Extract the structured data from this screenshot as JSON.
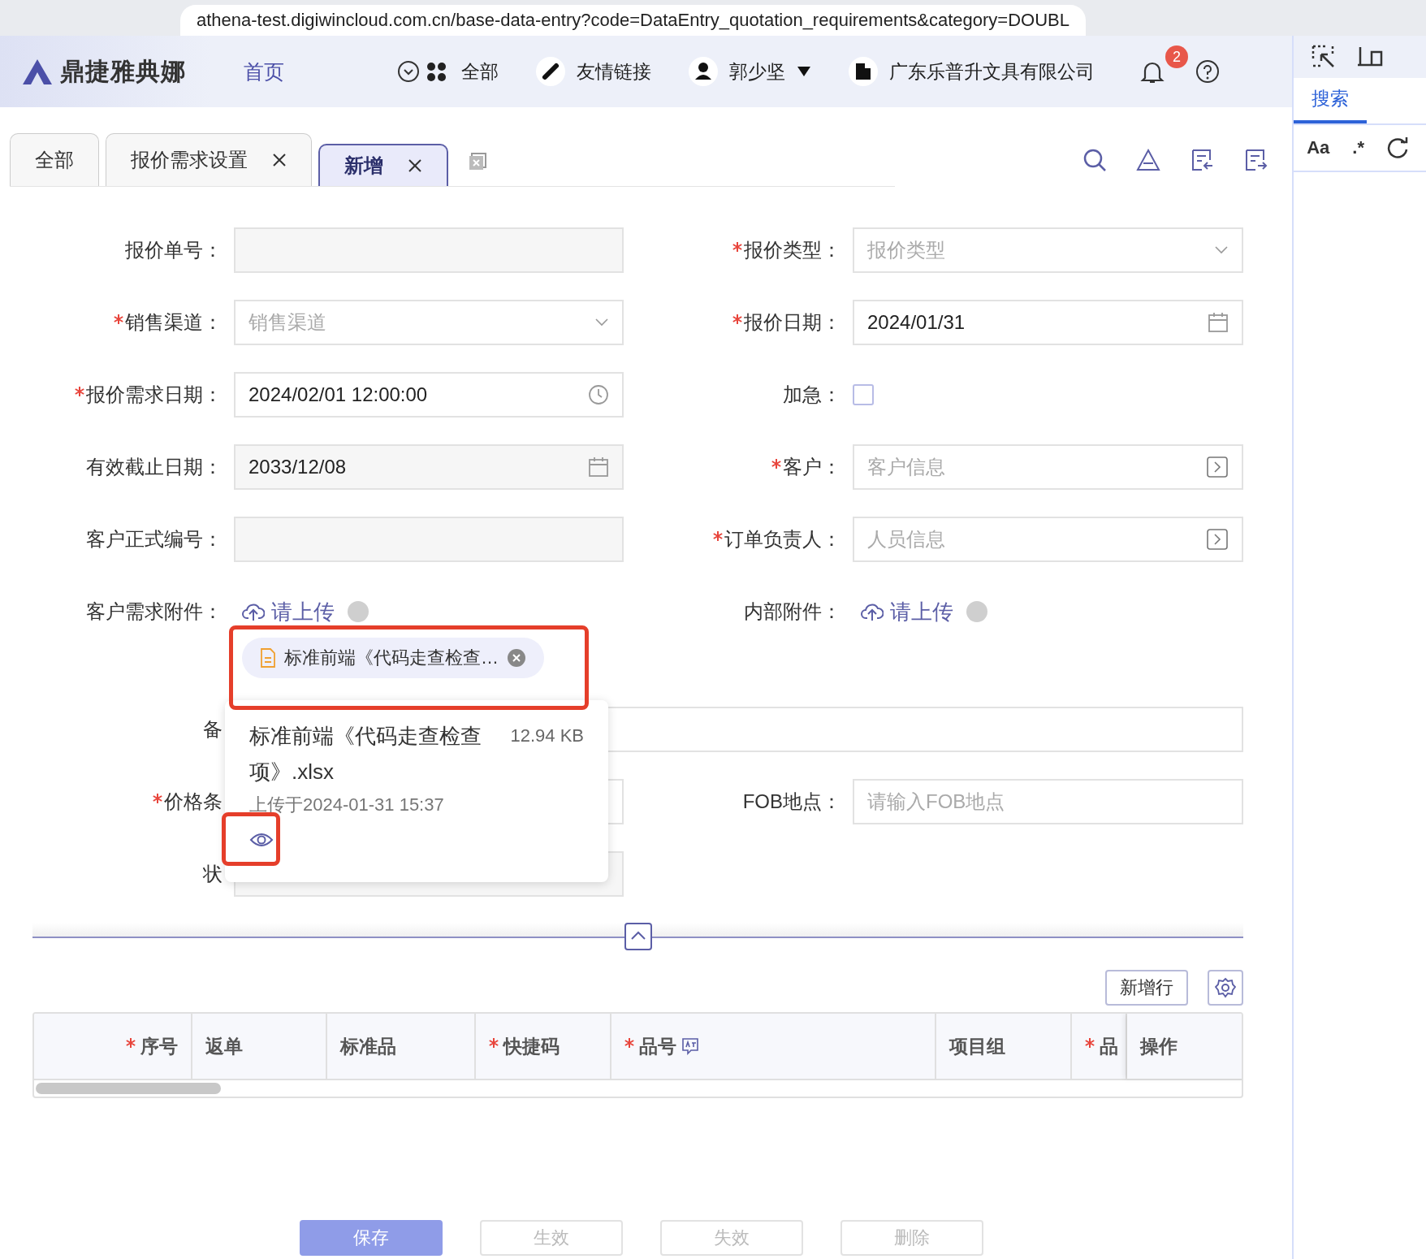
{
  "browser": {
    "url": "athena-test.digiwincloud.com.cn/base-data-entry?code=DataEntry_quotation_requirements&category=DOUBL"
  },
  "header": {
    "logo": "鼎捷雅典娜",
    "home": "首页",
    "nav": [
      {
        "kind": "all",
        "label": "全部"
      },
      {
        "kind": "link",
        "label": "友情链接"
      },
      {
        "kind": "user",
        "label": "郭少坚"
      },
      {
        "kind": "company",
        "label": "广东乐普升文具有限公司"
      }
    ],
    "notifications": "2"
  },
  "tabs": [
    {
      "label": "全部",
      "closable": false,
      "selected": false
    },
    {
      "label": "报价需求设置",
      "closable": true,
      "selected": false
    },
    {
      "label": "新增",
      "closable": true,
      "selected": true
    }
  ],
  "form": {
    "rows": [
      [
        {
          "label": "报价单号：",
          "required": false,
          "kind": "text",
          "disabled": true
        },
        {
          "label": "报价类型：",
          "required": true,
          "kind": "select",
          "placeholder": "报价类型"
        }
      ],
      [
        {
          "label": "销售渠道：",
          "required": true,
          "kind": "select",
          "placeholder": "销售渠道"
        },
        {
          "label": "报价日期：",
          "required": true,
          "kind": "date",
          "value": "2024/01/31"
        }
      ],
      [
        {
          "label": "报价需求日期：",
          "required": true,
          "kind": "time",
          "value": "2024/02/01 12:00:00"
        },
        {
          "label": "加急：",
          "required": false,
          "kind": "checkbox",
          "checked": false
        }
      ],
      [
        {
          "label": "有效截止日期：",
          "required": false,
          "kind": "date",
          "value": "2033/12/08",
          "disabled": true
        },
        {
          "label": "客户：",
          "required": true,
          "kind": "lookup",
          "placeholder": "客户信息"
        }
      ],
      [
        {
          "label": "客户正式编号：",
          "required": false,
          "kind": "text",
          "disabled": true
        },
        {
          "label": "订单负责人：",
          "required": true,
          "kind": "lookup",
          "placeholder": "人员信息"
        }
      ],
      [
        {
          "label": "客户需求附件：",
          "required": false,
          "kind": "upload",
          "action": "请上传",
          "file": "标准前端《代码走查检查…"
        },
        {
          "label": "内部附件：",
          "required": false,
          "kind": "upload",
          "action": "请上传"
        }
      ],
      [
        {
          "label": "备",
          "required": false,
          "kind": "wide"
        }
      ],
      [
        {
          "label": "价格条",
          "required": true,
          "kind": "text"
        },
        {
          "label": "FOB地点：",
          "required": false,
          "kind": "text",
          "placeholder": "请输入FOB地点"
        }
      ],
      [
        {
          "label": "状",
          "required": false,
          "kind": "text",
          "disabled": true
        }
      ]
    ]
  },
  "file_popup": {
    "name": "标准前端《代码走查检查项》.xlsx",
    "size": "12.94 KB",
    "uploaded": "上传于2024-01-31 15:37"
  },
  "table": {
    "add_row": "新增行",
    "columns": [
      {
        "label": "序号",
        "required": true
      },
      {
        "label": "返单",
        "required": false
      },
      {
        "label": "标准品",
        "required": false
      },
      {
        "label": "快捷码",
        "required": true
      },
      {
        "label": "品号",
        "required": true,
        "icon": true
      },
      {
        "label": "项目组",
        "required": false
      },
      {
        "label": "品",
        "required": true
      },
      {
        "label": "操作",
        "required": false
      }
    ]
  },
  "actions": [
    {
      "label": "保存",
      "primary": true
    },
    {
      "label": "生效",
      "primary": false
    },
    {
      "label": "失效",
      "primary": false
    },
    {
      "label": "删除",
      "primary": false
    }
  ],
  "devtools": {
    "tab": "搜索",
    "match_case": "Aa",
    "regex": ".*"
  }
}
